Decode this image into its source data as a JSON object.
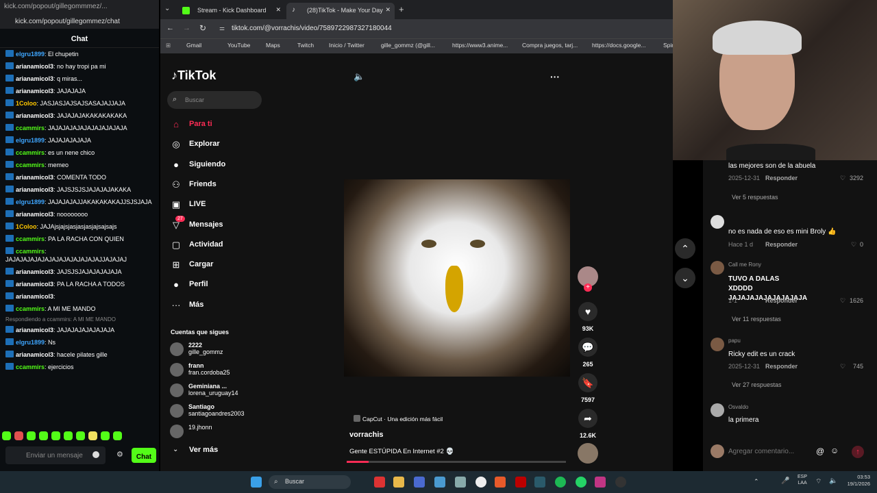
{
  "chat_window": {
    "url_top": "kick.com/popout/gillegommmez/...",
    "url": "kick.com/popout/gillegommez/chat",
    "header": "Chat",
    "messages": [
      {
        "user": "elgru1899",
        "text": "El chupetin",
        "color": "#3ea6ff"
      },
      {
        "user": "arianamicol3",
        "text": "no hay tropi pa mi",
        "color": "#ffffff"
      },
      {
        "user": "arianamicol3",
        "text": "q miras...",
        "color": "#ffffff"
      },
      {
        "user": "arianamicol3",
        "text": "JAJAJAJA",
        "color": "#ffffff"
      },
      {
        "user": "1Coloo",
        "text": "JASJASJAJSAJSASAJAJJAJA",
        "color": "#ffc800"
      },
      {
        "user": "arianamicol3",
        "text": "JAJAJAJAKAKAKAKAKA",
        "color": "#ffffff"
      },
      {
        "user": "ccammirs",
        "text": "JAJAJAJAJAJAJAJAJAJAJA",
        "color": "#53fc18"
      },
      {
        "user": "elgru1899",
        "text": "JAJAJAJAJAJA",
        "color": "#3ea6ff"
      },
      {
        "user": "ccammirs",
        "text": "es un nene chico",
        "color": "#53fc18"
      },
      {
        "user": "ccammirs",
        "text": "memeo",
        "color": "#53fc18"
      },
      {
        "user": "arianamicol3",
        "text": "COMENTA TODO",
        "color": "#ffffff"
      },
      {
        "user": "arianamicol3",
        "text": "JAJSJSJSJAJAJAJAKAKA",
        "color": "#ffffff"
      },
      {
        "user": "elgru1899",
        "text": "JAJAJAJAJJAKAKAKAKAJJSJSJAJA",
        "color": "#3ea6ff"
      },
      {
        "user": "arianamicol3",
        "text": "noooooooo",
        "color": "#ffffff"
      },
      {
        "user": "1Coloo",
        "text": "JAJAjsjajsjasjasjasjajsajsajs",
        "color": "#ffc800"
      },
      {
        "user": "ccammirs",
        "text": "PA LA RACHA CON QUIEN",
        "color": "#53fc18"
      },
      {
        "user": "ccammirs",
        "text": "JAJAJAJAJAJAJAJAJAJAJAJAJAJJAJAJAJ",
        "color": "#53fc18"
      },
      {
        "user": "arianamicol3",
        "text": "JAJSJSJAJAJAJAJAJA",
        "color": "#ffffff"
      },
      {
        "user": "arianamicol3",
        "text": "PA LA RACHA A TODOS",
        "color": "#ffffff"
      },
      {
        "user": "arianamicol3",
        "text": "",
        "color": "#ffffff"
      },
      {
        "user": "ccammirs",
        "text": "A MI ME MANDO",
        "color": "#53fc18"
      },
      {
        "reply": "Respondiendo a ccammirs: A MI ME MANDO",
        "user": "arianamicol3",
        "text": "JAJAJAJAJAJAJAJA",
        "color": "#ffffff"
      },
      {
        "user": "elgru1899",
        "text": "Ns",
        "color": "#3ea6ff"
      },
      {
        "user": "arianamicol3",
        "text": "hacele pilates gille",
        "color": "#ffffff"
      },
      {
        "user": "ccammirs",
        "text": "ejercicios",
        "color": "#53fc18"
      }
    ],
    "input_placeholder": "Enviar un mensaje",
    "chat_button": "Chat"
  },
  "browser": {
    "tabs": [
      {
        "label": "Stream - Kick Dashboard",
        "active": false
      },
      {
        "label": "(28)TikTok - Make Your Day",
        "active": true
      }
    ],
    "url": "tiktok.com/@vorrachis/video/7589722987327180044",
    "bookmarks": [
      "Gmail",
      "YouTube",
      "Maps",
      "Twitch",
      "Inicio / Twitter",
      "gille_gommz (@gill...",
      "https://www3.anime...",
      "Compra juegos, tarj...",
      "https://docs.google...",
      "Spir"
    ]
  },
  "tiktok": {
    "logo": "TikTok",
    "search_placeholder": "Buscar",
    "nav": [
      {
        "label": "Para ti",
        "icon": "home-icon",
        "active": true
      },
      {
        "label": "Explorar",
        "icon": "compass-icon"
      },
      {
        "label": "Siguiendo",
        "icon": "following-avatar-icon"
      },
      {
        "label": "Friends",
        "icon": "friends-icon"
      },
      {
        "label": "LIVE",
        "icon": "live-icon"
      },
      {
        "label": "Mensajes",
        "icon": "messages-icon",
        "badge": "27"
      },
      {
        "label": "Actividad",
        "icon": "activity-icon"
      },
      {
        "label": "Cargar",
        "icon": "upload-icon"
      },
      {
        "label": "Perfil",
        "icon": "profile-icon"
      },
      {
        "label": "Más",
        "icon": "more-icon"
      }
    ],
    "following_title": "Cuentas que sigues",
    "accounts": [
      {
        "name": "2222",
        "handle": "gille_gommz"
      },
      {
        "name": "frann",
        "handle": "fran.cordoba25"
      },
      {
        "name": "Geminiana ...",
        "handle": "lorena_uruguay14"
      },
      {
        "name": "Santiago",
        "handle": "santiagoandres2003"
      },
      {
        "name": "",
        "handle": "19.jhonn"
      }
    ],
    "see_more": "Ver más",
    "video": {
      "capcut": "CapCut · Una edición más fácil",
      "author": "vorrachis",
      "caption": "Gente ESTÚPIDA En Internet #2 💀",
      "progress": 0.1
    },
    "actions": {
      "likes": "93K",
      "comments": "265",
      "saves": "7597",
      "shares": "12.6K"
    }
  },
  "comments": [
    {
      "user": "",
      "text": "las mejores son de la abuela",
      "date": "2025-12-31",
      "reply": "Responder",
      "likes": "3292",
      "more": "Ver 5 respuestas"
    },
    {
      "user": "",
      "text": "no es nada de eso es mini Broly 👍",
      "date": "Hace 1 d",
      "reply": "Responder",
      "likes": "0",
      "more": ""
    },
    {
      "user": "Call me Rony",
      "text": "TUVO A DALAS XDDDD JAJAJAJAJAJAJAJAJA",
      "date": "1-1",
      "reply": "Responder",
      "likes": "1626",
      "more": "Ver 11 respuestas"
    },
    {
      "user": "papu",
      "text": "Ricky edit es un crack",
      "date": "2025-12-31",
      "reply": "Responder",
      "likes": "745",
      "more": "Ver 27 respuestas"
    },
    {
      "user": "Osvaldo",
      "text": "la primera",
      "date": "",
      "reply": "",
      "likes": "",
      "more": ""
    }
  ],
  "comment_input_placeholder": "Agregar comentario...",
  "taskbar": {
    "search": "Buscar",
    "lang": "ESP",
    "lang2": "LAA",
    "time": "03:53",
    "date": "19/1/2026"
  },
  "colors": {
    "kick_green": "#53fc18",
    "tiktok_red": "#fe2c55",
    "bg": "#121212"
  }
}
